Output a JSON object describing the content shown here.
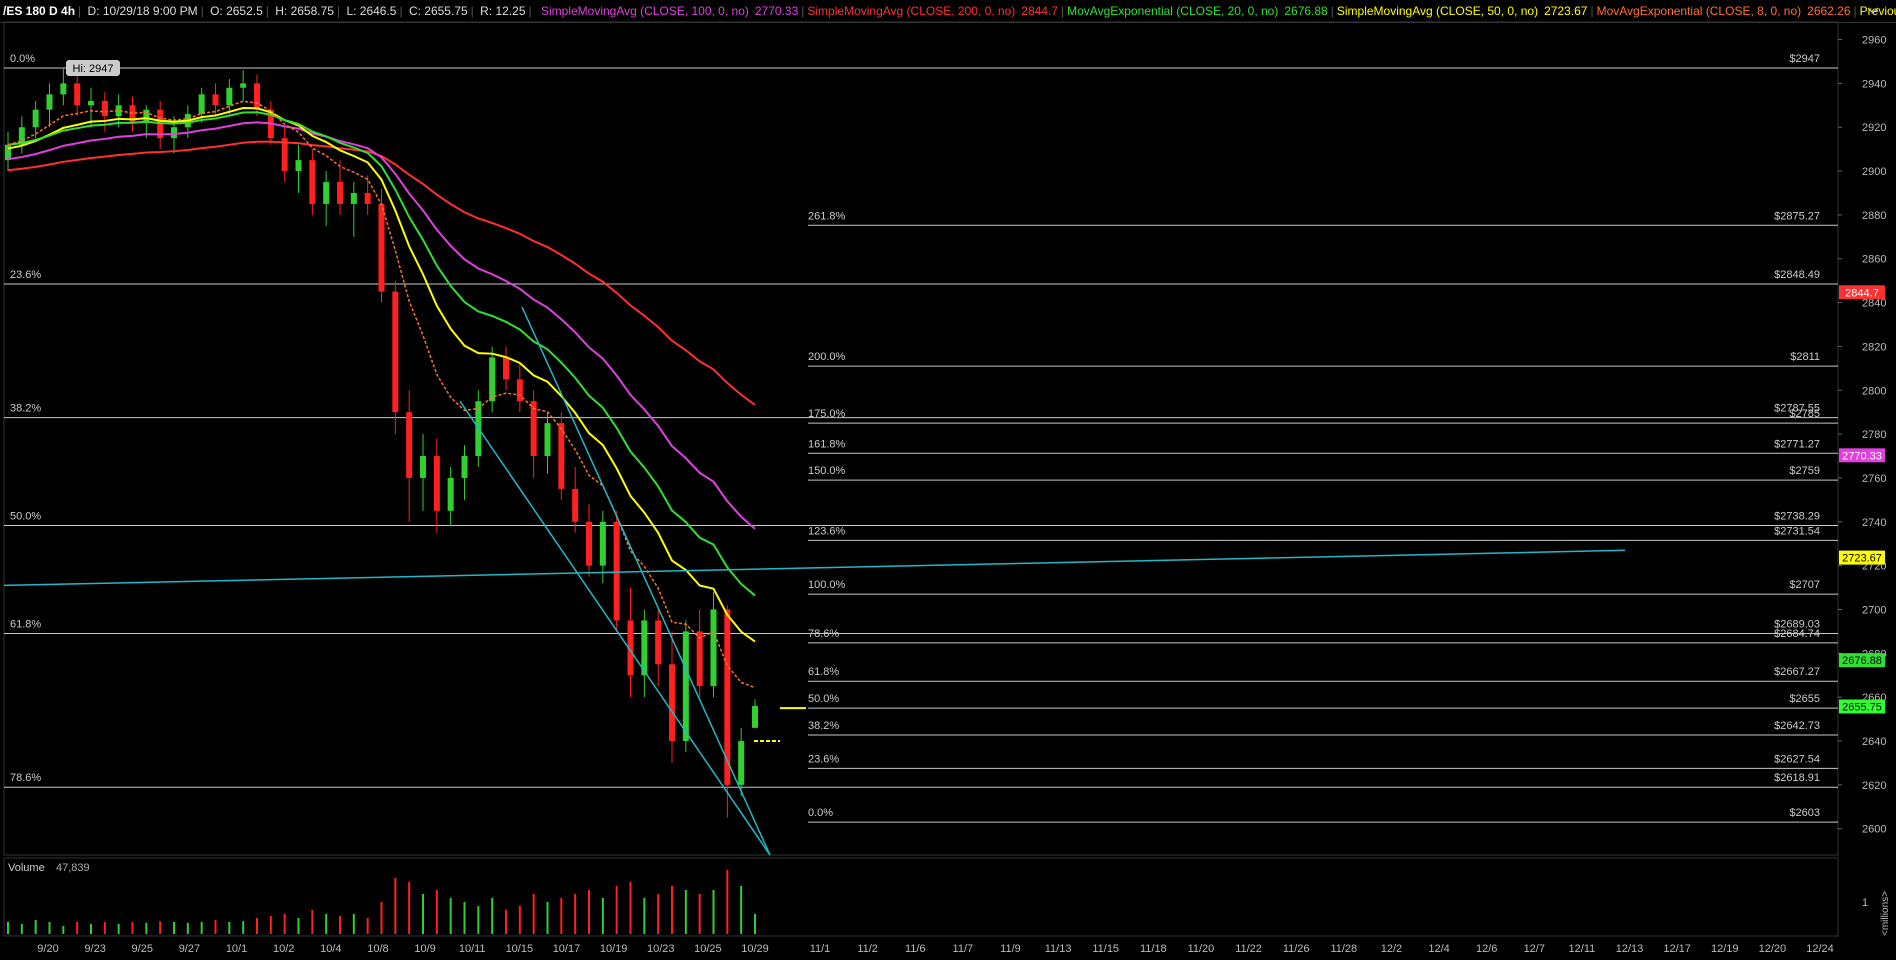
{
  "topbar": {
    "symbol": "/ES 180 D 4h",
    "date": "D: 10/29/18 9:00 PM",
    "open": "O: 2652.5",
    "high": "H: 2658.75",
    "low": "L: 2646.5",
    "close": "C: 2655.75",
    "range": "R: 12.25",
    "studies": [
      {
        "label": "SimpleMovingAvg (CLOSE, 100, 0, no)",
        "value": "2770.33",
        "color": "#e040e0"
      },
      {
        "label": "SimpleMovingAvg (CLOSE, 200, 0, no)",
        "value": "2844.7",
        "color": "#ff3030"
      },
      {
        "label": "MovAvgExponential (CLOSE, 20, 0, no)",
        "value": "2676.88",
        "color": "#30e030"
      },
      {
        "label": "SimpleMovingAvg (CLOSE, 50, 0, no)",
        "value": "2723.67",
        "color": "#ffff00"
      },
      {
        "label": "MovAvgExponential (CLOSE, 8, 0, no)",
        "value": "2662.26",
        "color": "#ff7030"
      },
      {
        "label": "Previousclose (DAY,...",
        "value": "",
        "color": "#ffff00"
      }
    ]
  },
  "hi_label": "Hi: 2947",
  "volume_label": "Volume",
  "volume_value": "47,839",
  "volume_axis": {
    "tick": "1",
    "unit": "<millions>"
  },
  "colors": {
    "bg": "#000000",
    "grid": "#1a1a1a",
    "fib": "#c8c8c8",
    "channel": "#22b8c8",
    "sma100": "#e040e0",
    "sma200": "#ff3030",
    "ema20": "#30e030",
    "sma50": "#ffff00",
    "ema8": "#ff7030",
    "up": "#30d030",
    "down": "#ff2020"
  },
  "chart_data": {
    "type": "candlestick",
    "y_range": [
      2588,
      2968
    ],
    "y_ticks": [
      2600,
      2620,
      2640,
      2660,
      2680,
      2700,
      2720,
      2740,
      2760,
      2780,
      2800,
      2820,
      2840,
      2860,
      2880,
      2900,
      2920,
      2940,
      2960
    ],
    "x_labels": [
      "9/20",
      "9/23",
      "9/25",
      "9/27",
      "10/1",
      "10/2",
      "10/4",
      "10/8",
      "10/9",
      "10/11",
      "10/15",
      "10/17",
      "10/19",
      "10/23",
      "10/25",
      "10/29",
      "11/1",
      "11/2",
      "11/6",
      "11/7",
      "11/9",
      "11/13",
      "11/15",
      "11/18",
      "11/20",
      "11/22",
      "11/26",
      "11/28",
      "12/2",
      "12/4",
      "12/6",
      "12/7",
      "12/11",
      "12/13",
      "12/17",
      "12/19",
      "12/20",
      "12/24"
    ],
    "fib_retracement": [
      {
        "label": "0.0%",
        "price": 2947
      },
      {
        "label": "23.6%",
        "price": 2848.49
      },
      {
        "label": "38.2%",
        "price": 2787.55
      },
      {
        "label": "50.0%",
        "price": 2738.29
      },
      {
        "label": "61.8%",
        "price": 2689.03
      },
      {
        "label": "78.6%",
        "price": 2618.91
      }
    ],
    "fib_extension": [
      {
        "label": "261.8%",
        "price": 2875.27,
        "price_label": "$2875.27"
      },
      {
        "label": "200.0%",
        "price": 2811,
        "price_label": "$2811"
      },
      {
        "label": "175.0%",
        "price": 2785,
        "price_label": "$2785"
      },
      {
        "label": "161.8%",
        "price": 2771.27,
        "price_label": "$2771.27"
      },
      {
        "label": "150.0%",
        "price": 2759,
        "price_label": "$2759"
      },
      {
        "label": "123.6%",
        "price": 2731.54,
        "price_label": "$2731.54"
      },
      {
        "label": "100.0%",
        "price": 2707,
        "price_label": "$2707"
      },
      {
        "label": "78.6%",
        "price": 2684.74,
        "price_label": "$2684.74"
      },
      {
        "label": "61.8%",
        "price": 2667.27,
        "price_label": "$2667.27"
      },
      {
        "label": "50.0%",
        "price": 2655,
        "price_label": "$2655"
      },
      {
        "label": "38.2%",
        "price": 2642.73,
        "price_label": "$2642.73"
      },
      {
        "label": "23.6%",
        "price": 2627.54,
        "price_label": "$2627.54"
      },
      {
        "label": "0.0%",
        "price": 2603,
        "price_label": "$2603"
      }
    ],
    "retracement_price_labels": [
      {
        "price": 2947,
        "label": "$2947"
      },
      {
        "price": 2848.49,
        "label": "$2848.49"
      },
      {
        "price": 2787.55,
        "label": "$2787.55"
      },
      {
        "price": 2738.29,
        "label": "$2738.29"
      },
      {
        "price": 2689.03,
        "label": "$2689.03"
      },
      {
        "price": 2618.91,
        "label": "$2618.91"
      }
    ],
    "study_badges": [
      {
        "value": "2844.7",
        "color": "#ff3030",
        "text": "#fff"
      },
      {
        "value": "2770.33",
        "color": "#e040e0",
        "text": "#fff"
      },
      {
        "value": "2723.67",
        "color": "#ffff00",
        "text": "#000"
      },
      {
        "value": "2676.88",
        "color": "#30e030",
        "text": "#000"
      },
      {
        "value": "2655.75",
        "color": "#30ff30",
        "text": "#000"
      }
    ],
    "ohlc": [
      [
        2905,
        2918,
        2900,
        2912
      ],
      [
        2912,
        2925,
        2908,
        2920
      ],
      [
        2920,
        2932,
        2915,
        2928
      ],
      [
        2928,
        2940,
        2920,
        2935
      ],
      [
        2935,
        2947,
        2930,
        2940
      ],
      [
        2940,
        2944,
        2925,
        2930
      ],
      [
        2930,
        2938,
        2920,
        2932
      ],
      [
        2932,
        2936,
        2918,
        2925
      ],
      [
        2925,
        2935,
        2920,
        2930
      ],
      [
        2930,
        2934,
        2918,
        2922
      ],
      [
        2922,
        2930,
        2915,
        2928
      ],
      [
        2928,
        2932,
        2910,
        2915
      ],
      [
        2915,
        2925,
        2908,
        2920
      ],
      [
        2920,
        2930,
        2915,
        2926
      ],
      [
        2926,
        2938,
        2922,
        2935
      ],
      [
        2935,
        2940,
        2925,
        2930
      ],
      [
        2930,
        2942,
        2926,
        2938
      ],
      [
        2938,
        2946,
        2932,
        2940
      ],
      [
        2940,
        2944,
        2925,
        2928
      ],
      [
        2928,
        2932,
        2912,
        2915
      ],
      [
        2915,
        2920,
        2895,
        2900
      ],
      [
        2900,
        2912,
        2890,
        2905
      ],
      [
        2905,
        2910,
        2880,
        2885
      ],
      [
        2885,
        2900,
        2875,
        2895
      ],
      [
        2895,
        2905,
        2880,
        2885
      ],
      [
        2885,
        2895,
        2870,
        2890
      ],
      [
        2890,
        2898,
        2880,
        2885
      ],
      [
        2885,
        2892,
        2840,
        2845
      ],
      [
        2845,
        2850,
        2780,
        2790
      ],
      [
        2790,
        2800,
        2740,
        2760
      ],
      [
        2760,
        2780,
        2745,
        2770
      ],
      [
        2770,
        2778,
        2735,
        2745
      ],
      [
        2745,
        2765,
        2738,
        2760
      ],
      [
        2760,
        2775,
        2750,
        2770
      ],
      [
        2770,
        2800,
        2765,
        2795
      ],
      [
        2795,
        2820,
        2790,
        2815
      ],
      [
        2815,
        2820,
        2800,
        2805
      ],
      [
        2805,
        2812,
        2790,
        2795
      ],
      [
        2795,
        2800,
        2760,
        2770
      ],
      [
        2770,
        2790,
        2762,
        2785
      ],
      [
        2785,
        2790,
        2750,
        2755
      ],
      [
        2755,
        2765,
        2735,
        2740
      ],
      [
        2740,
        2748,
        2715,
        2720
      ],
      [
        2720,
        2745,
        2712,
        2740
      ],
      [
        2740,
        2745,
        2690,
        2695
      ],
      [
        2695,
        2710,
        2660,
        2670
      ],
      [
        2670,
        2700,
        2660,
        2695
      ],
      [
        2695,
        2700,
        2665,
        2675
      ],
      [
        2675,
        2690,
        2630,
        2640
      ],
      [
        2640,
        2695,
        2635,
        2690
      ],
      [
        2690,
        2700,
        2660,
        2665
      ],
      [
        2665,
        2708,
        2660,
        2700
      ],
      [
        2700,
        2702,
        2605,
        2620
      ],
      [
        2620,
        2646,
        2615,
        2640
      ],
      [
        2646,
        2659,
        2646,
        2656
      ]
    ],
    "volume": [
      0.3,
      0.25,
      0.35,
      0.3,
      0.2,
      0.3,
      0.25,
      0.3,
      0.25,
      0.3,
      0.28,
      0.32,
      0.3,
      0.28,
      0.3,
      0.35,
      0.3,
      0.32,
      0.4,
      0.45,
      0.5,
      0.4,
      0.6,
      0.5,
      0.45,
      0.5,
      0.4,
      0.8,
      1.4,
      1.3,
      1.0,
      1.1,
      0.9,
      0.8,
      0.7,
      0.9,
      0.6,
      0.7,
      1.0,
      0.8,
      0.9,
      1.0,
      1.1,
      0.9,
      1.2,
      1.3,
      0.9,
      1.0,
      1.2,
      1.1,
      1.0,
      1.1,
      1.6,
      1.2,
      0.5
    ]
  }
}
